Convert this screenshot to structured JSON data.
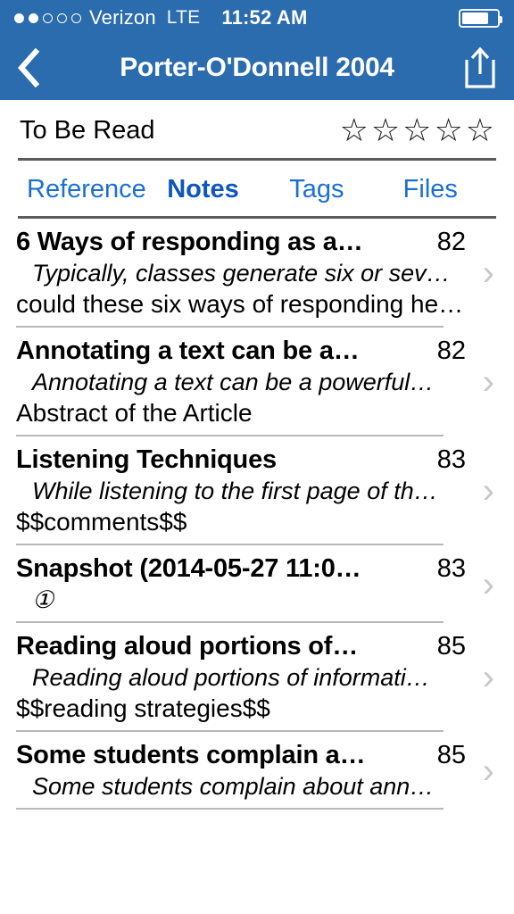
{
  "status_bar": {
    "signal_dots_total": 5,
    "signal_dots_filled": 2,
    "carrier": "Verizon",
    "network": "LTE",
    "time": "11:52 AM",
    "battery_percent": 75
  },
  "nav_bar": {
    "back_icon": "chevron-left-icon",
    "title": "Porter-O'Donnell 2004",
    "share_icon": "share-icon",
    "background_color": "#2a6cad"
  },
  "detail_header": {
    "read_status": "To Be Read",
    "rating": 0,
    "rating_max": 5,
    "star_empty": "☆",
    "star_filled": "★"
  },
  "tabs": [
    {
      "label": "Reference",
      "active": false
    },
    {
      "label": "Notes",
      "active": true
    },
    {
      "label": "Tags",
      "active": false
    },
    {
      "label": "Files",
      "active": false
    }
  ],
  "accent_color": "#1a6fd4",
  "accent_active_color": "#0c56bd",
  "notes": [
    {
      "title": "6 Ways of responding as a…",
      "page": "82",
      "quote": "Typically, classes generate six or sev…",
      "note": "could these six ways of responding he…",
      "chevron": "›"
    },
    {
      "title": "Annotating a text can be a…",
      "page": "82",
      "quote": "Annotating a text can be a powerful…",
      "note": "Abstract of the Article",
      "chevron": "›"
    },
    {
      "title": "Listening Techniques",
      "page": "83",
      "quote": "While listening to the first page of th…",
      "note": "$$comments$$",
      "chevron": "›"
    },
    {
      "title": "Snapshot (2014-05-27 11:0…",
      "page": "83",
      "quote": "①",
      "note": "",
      "chevron": "›"
    },
    {
      "title": "Reading aloud portions of…",
      "page": "85",
      "quote": "Reading aloud portions of informati…",
      "note": "$$reading strategies$$",
      "chevron": "›"
    },
    {
      "title": "Some students complain a…",
      "page": "85",
      "quote": "Some students complain about ann…",
      "note": "",
      "chevron": "›"
    }
  ]
}
